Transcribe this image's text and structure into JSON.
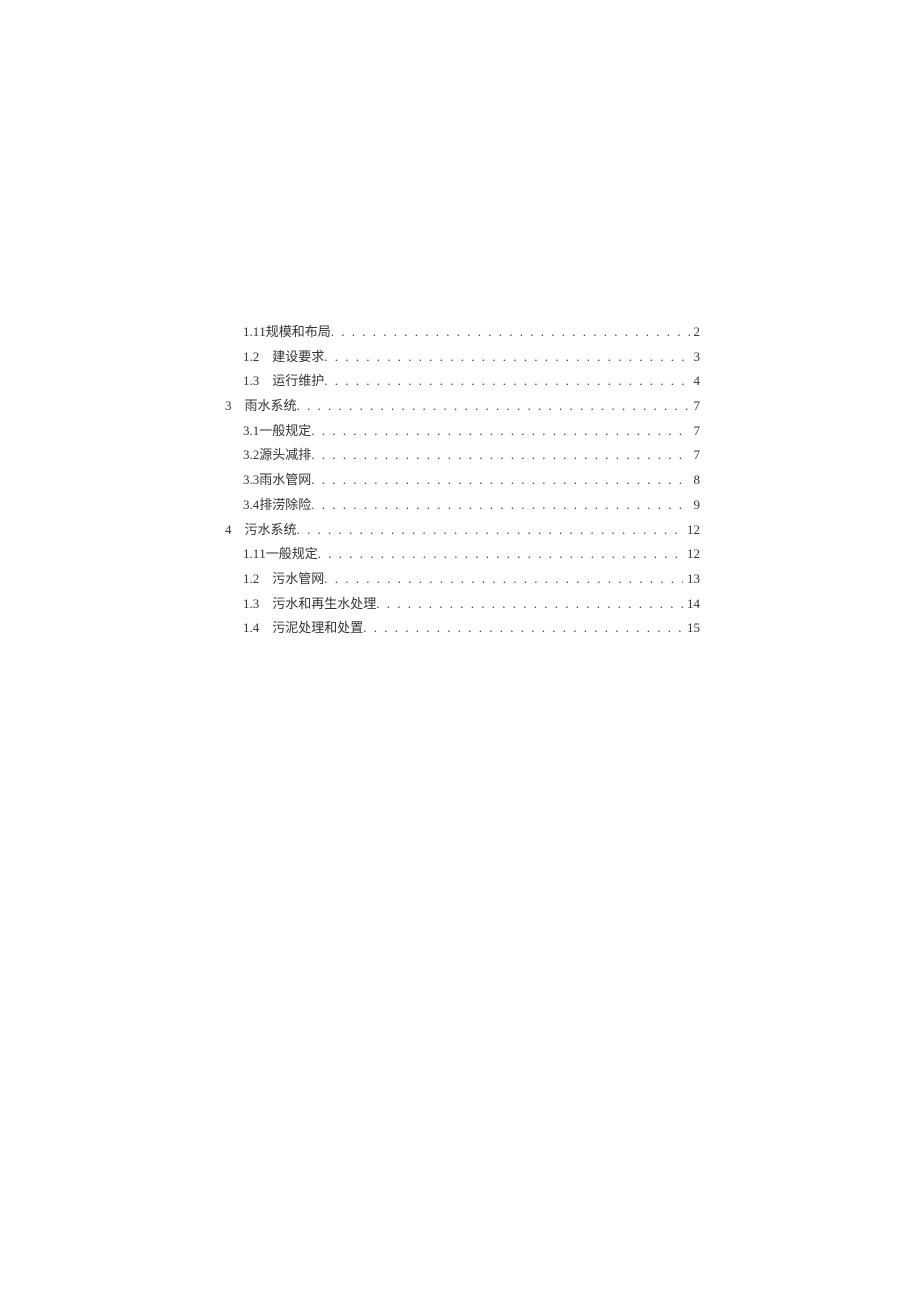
{
  "toc": [
    {
      "level": "section",
      "num": "1.1",
      "gap": " 1 ",
      "title": "规模和布局",
      "page": "2"
    },
    {
      "level": "section",
      "num": "1.2",
      "gap": "　",
      "title": "建设要求",
      "page": "3"
    },
    {
      "level": "section",
      "num": "1.3",
      "gap": "　",
      "title": "运行维护",
      "page": "4"
    },
    {
      "level": "chapter",
      "num": "3",
      "gap": "　",
      "title": "雨水系统",
      "page": "7"
    },
    {
      "level": "section",
      "num": "3.1",
      "gap": " ",
      "title": "一般规定",
      "page": "7"
    },
    {
      "level": "section",
      "num": "3.2",
      "gap": " ",
      "title": "源头减排",
      "page": "7"
    },
    {
      "level": "section",
      "num": "3.3",
      "gap": " ",
      "title": "雨水管网",
      "page": "8"
    },
    {
      "level": "section",
      "num": "3.4",
      "gap": " ",
      "title": "排涝除险",
      "page": "9"
    },
    {
      "level": "chapter",
      "num": "4",
      "gap": "　",
      "title": "污水系统",
      "page": "12"
    },
    {
      "level": "section",
      "num": "1.1",
      "gap": " 1 ",
      "title": "一般规定",
      "page": "12"
    },
    {
      "level": "section",
      "num": "1.2",
      "gap": "　",
      "title": "污水管网",
      "page": "13"
    },
    {
      "level": "section",
      "num": "1.3",
      "gap": "　",
      "title": "污水和再生水处理",
      "page": "14"
    },
    {
      "level": "section",
      "num": "1.4",
      "gap": "　",
      "title": "污泥处理和处置",
      "page": "15"
    }
  ]
}
